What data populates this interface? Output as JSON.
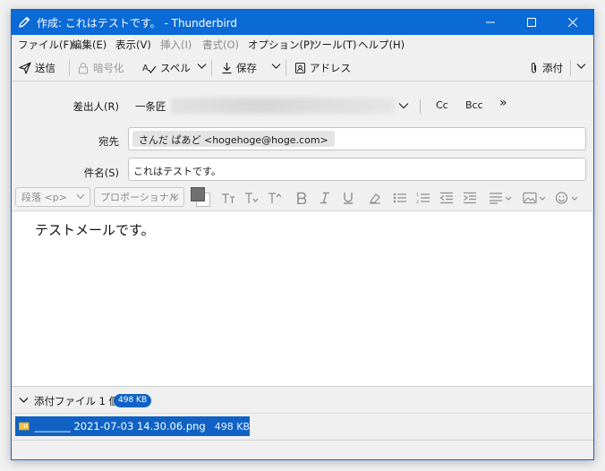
{
  "window": {
    "title": "作成: これはテストです。 - Thunderbird"
  },
  "menu": {
    "items": [
      {
        "label": "ファイル(F)",
        "enabled": true
      },
      {
        "label": "編集(E)",
        "enabled": true
      },
      {
        "label": "表示(V)",
        "enabled": true
      },
      {
        "label": "挿入(I)",
        "enabled": false
      },
      {
        "label": "書式(O)",
        "enabled": false
      },
      {
        "label": "オプション(P)",
        "enabled": true
      },
      {
        "label": "ツール(T)",
        "enabled": true
      },
      {
        "label": "ヘルプ(H)",
        "enabled": true
      }
    ]
  },
  "toolbar": {
    "send_label": "送信",
    "encrypt_label": "暗号化",
    "spell_label": "スペル",
    "save_label": "保存",
    "address_label": "アドレス",
    "attach_label": "添付"
  },
  "header": {
    "from_label": "差出人(R)",
    "from_value": "一条匠",
    "cc_label": "Cc",
    "bcc_label": "Bcc",
    "more_label": "»",
    "to_label": "宛先",
    "to_recipient": "さんだ ぱあど <hogehoge@hoge.com>",
    "subject_label": "件名(S)",
    "subject_value": "これはテストです。"
  },
  "format": {
    "paragraph_select": "段落 <p>",
    "font_select": "プロポーショナル"
  },
  "body": {
    "text": "テストメールです。"
  },
  "attachments": {
    "title": "添付ファイル 1 個",
    "total_size": "498 KB",
    "items": [
      {
        "name": "_______ 2021-07-03 14.30.06.png",
        "size": "498 KB"
      }
    ]
  },
  "colors": {
    "accent": "#0a6ad6",
    "selection": "#1062c4"
  }
}
